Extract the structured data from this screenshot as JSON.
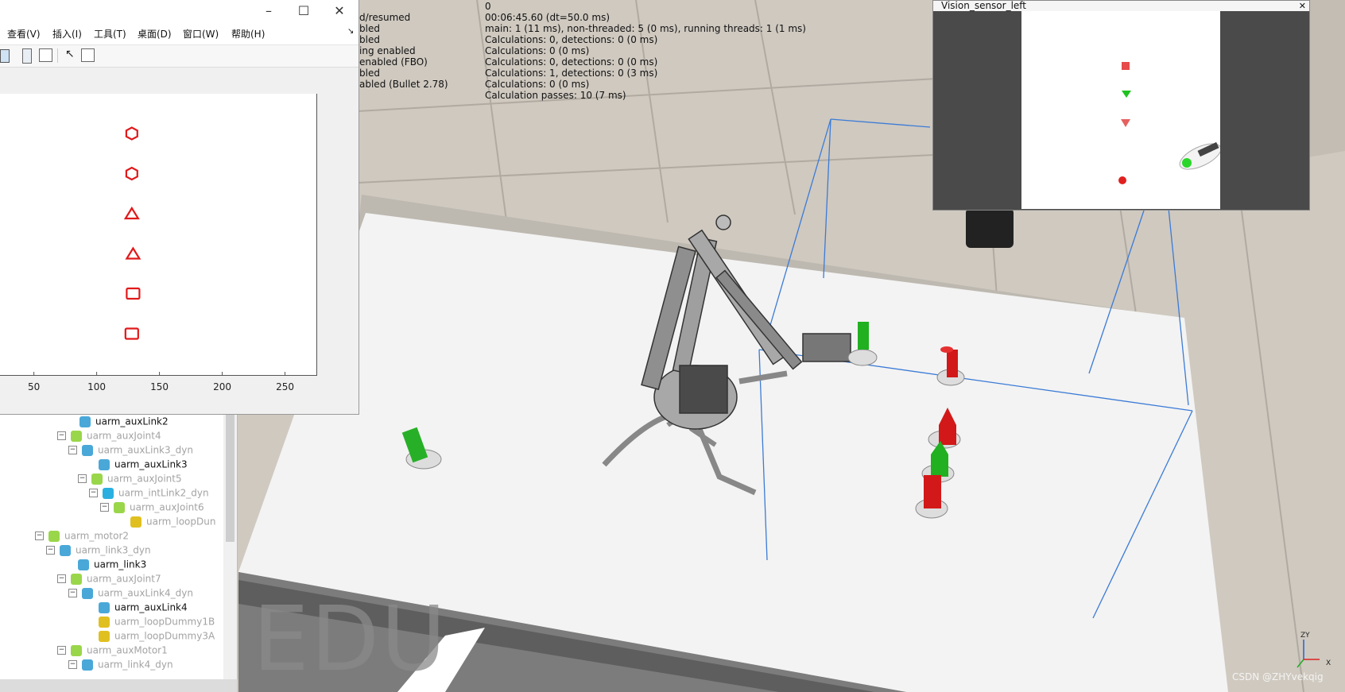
{
  "info_lines": [
    {
      "left": "",
      "right": "0"
    },
    {
      "left": "d/resumed",
      "right": "00:06:45.60 (dt=50.0 ms)"
    },
    {
      "left": "bled",
      "right": "main: 1 (11 ms), non-threaded: 5 (0 ms), running threads: 1 (1 ms)"
    },
    {
      "left": "bled",
      "right": "Calculations: 0, detections: 0 (0 ms)"
    },
    {
      "left": "ing enabled",
      "right": "Calculations: 0 (0 ms)"
    },
    {
      "left": "enabled (FBO)",
      "right": "Calculations: 0, detections: 0 (0 ms)"
    },
    {
      "left": "bled",
      "right": "Calculations: 1, detections: 0 (3 ms)"
    },
    {
      "left": "abled (Bullet 2.78)",
      "right": "Calculations: 0 (0 ms)"
    },
    {
      "left": "",
      "right": "Calculation passes: 10 (7 ms)"
    }
  ],
  "figure_window": {
    "controls": {
      "minimize": "–",
      "maximize": "☐",
      "close": "✕"
    },
    "menus": [
      "查看(V)",
      "插入(I)",
      "工具(T)",
      "桌面(D)",
      "窗口(W)",
      "帮助(H)"
    ],
    "menu_corner": "↘"
  },
  "chart_data": {
    "type": "scatter",
    "x_ticks": [
      "50",
      "100",
      "150",
      "200",
      "250"
    ],
    "points": [
      {
        "shape": "hexagon",
        "x": 128,
        "y": 1
      },
      {
        "shape": "hexagon",
        "x": 128,
        "y": 2
      },
      {
        "shape": "triangle",
        "x": 128,
        "y": 3
      },
      {
        "shape": "triangle",
        "x": 129,
        "y": 4
      },
      {
        "shape": "square",
        "x": 129,
        "y": 5
      },
      {
        "shape": "square",
        "x": 128,
        "y": 6
      }
    ],
    "marker_color": "#e0191a"
  },
  "vision_sensor": {
    "title": "Vision_sensor_left",
    "close": "✕"
  },
  "tree": [
    {
      "label": "uarm_auxLink2",
      "style": "strong",
      "icon": "shape-icon"
    },
    {
      "label": "uarm_auxJoint4",
      "style": "dim",
      "icon": "joint-icon",
      "expand": "⊟"
    },
    {
      "label": "uarm_auxLink3_dyn",
      "style": "dim",
      "icon": "shape-icon",
      "expand": "⊟"
    },
    {
      "label": "uarm_auxLink3",
      "style": "strong",
      "icon": "shape-icon"
    },
    {
      "label": "uarm_auxJoint5",
      "style": "dim",
      "icon": "joint-icon",
      "expand": "⊟"
    },
    {
      "label": "uarm_intLink2_dyn",
      "style": "dim",
      "icon": "cube-icon",
      "expand": "⊟"
    },
    {
      "label": "uarm_auxJoint6",
      "style": "dim",
      "icon": "joint-icon",
      "expand": "⊟"
    },
    {
      "label": "uarm_loopDun",
      "style": "dim",
      "icon": "dummy-icon"
    },
    {
      "label": "uarm_motor2",
      "style": "dim",
      "icon": "joint-icon",
      "expand": "⊟"
    },
    {
      "label": "uarm_link3_dyn",
      "style": "dim",
      "icon": "shape-icon",
      "expand": "⊟"
    },
    {
      "label": "uarm_link3",
      "style": "strong",
      "icon": "shape-icon"
    },
    {
      "label": "uarm_auxJoint7",
      "style": "dim",
      "icon": "joint-icon",
      "expand": "⊟"
    },
    {
      "label": "uarm_auxLink4_dyn",
      "style": "dim",
      "icon": "shape-icon",
      "expand": "⊟"
    },
    {
      "label": "uarm_auxLink4",
      "style": "strong",
      "icon": "shape-icon"
    },
    {
      "label": "uarm_loopDummy1B",
      "style": "dim",
      "icon": "dummy-icon"
    },
    {
      "label": "uarm_loopDummy3A",
      "style": "dim",
      "icon": "dummy-icon"
    },
    {
      "label": "uarm_auxMotor1",
      "style": "dim",
      "icon": "joint-icon",
      "expand": "⊟"
    },
    {
      "label": "uarm_link4_dyn",
      "style": "dim",
      "icon": "shape-icon",
      "expand": "⊟"
    }
  ],
  "watermark_edu": "EDU",
  "credit": "CSDN @ZHYvekqig",
  "axis_triad": {
    "x": "X",
    "zy": "ZY"
  },
  "colors": {
    "red": "#d61b1b",
    "green": "#22b322",
    "floor": "#d8d2c8",
    "table": "#f2f2f2"
  }
}
